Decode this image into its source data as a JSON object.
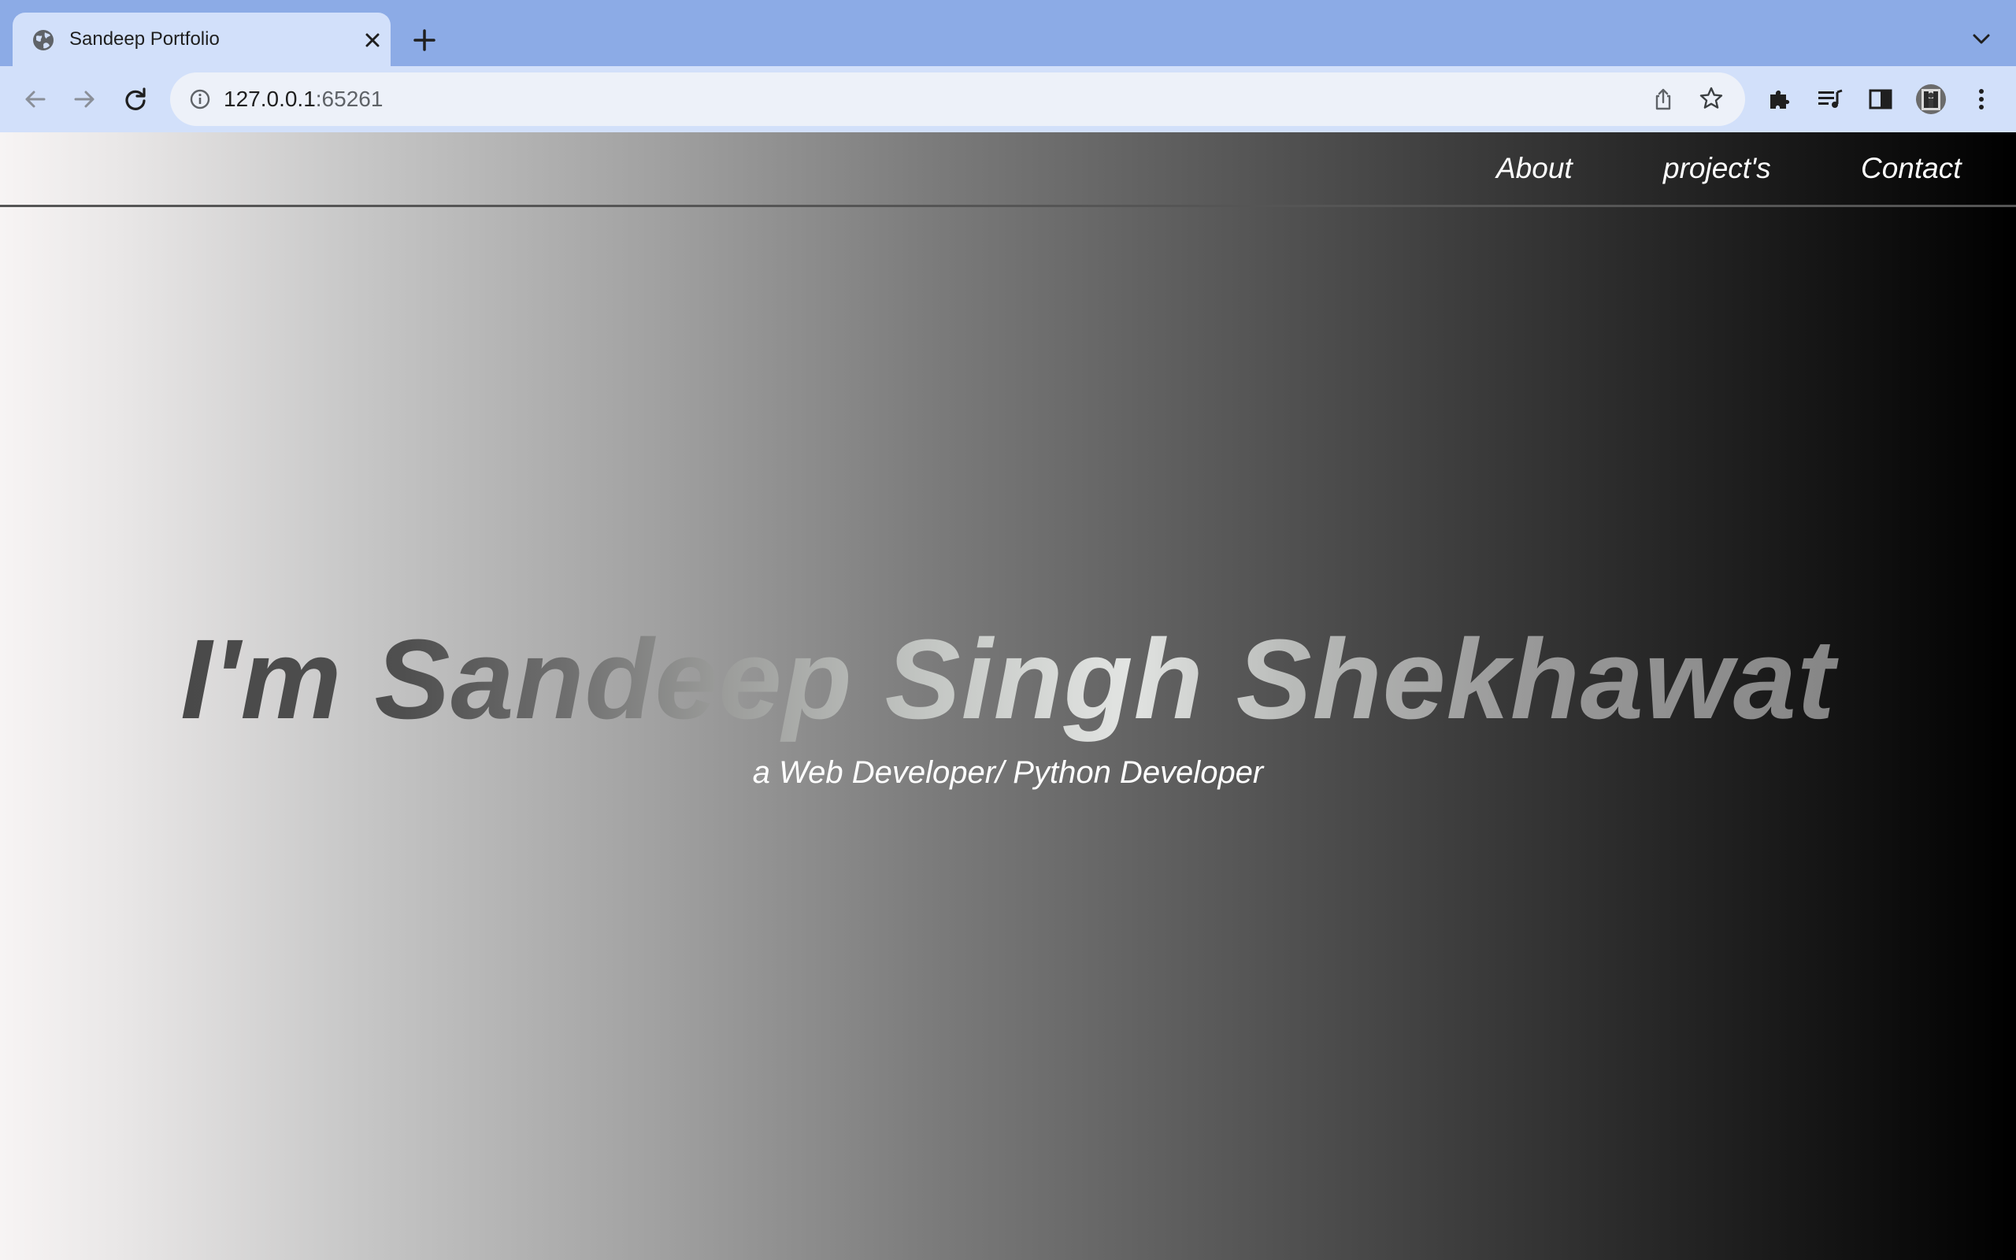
{
  "browser": {
    "tab": {
      "title": "Sandeep Portfolio"
    },
    "address": {
      "host": "127.0.0.1",
      "port": ":65261"
    },
    "colors": {
      "tabstrip": "#8cabe6",
      "toolbar": "#d2e0fa",
      "omnibox": "#edf1f9"
    },
    "icons": {
      "favicon": "globe-icon",
      "tab_close": "close-icon",
      "new_tab": "plus-icon",
      "tab_search": "chevron-down-icon",
      "back": "arrow-left-icon",
      "forward": "arrow-right-icon",
      "reload": "reload-icon",
      "site_info": "info-icon",
      "share": "share-icon",
      "bookmark": "star-icon",
      "extensions": "puzzle-icon",
      "media": "media-control-icon",
      "side_panel": "side-panel-icon",
      "profile": "avatar",
      "menu": "kebab-menu-icon"
    }
  },
  "page": {
    "nav": {
      "items": [
        {
          "label": "About"
        },
        {
          "label": "project's"
        },
        {
          "label": "Contact"
        }
      ]
    },
    "hero": {
      "title": "I'm Sandeep Singh Shekhawat",
      "subtitle": "a Web Developer/ Python Developer"
    },
    "colors": {
      "gradient_start": "#f7f4f4",
      "gradient_end": "#000000",
      "nav_text": "#ffffff",
      "nav_rule": "#555555"
    }
  }
}
